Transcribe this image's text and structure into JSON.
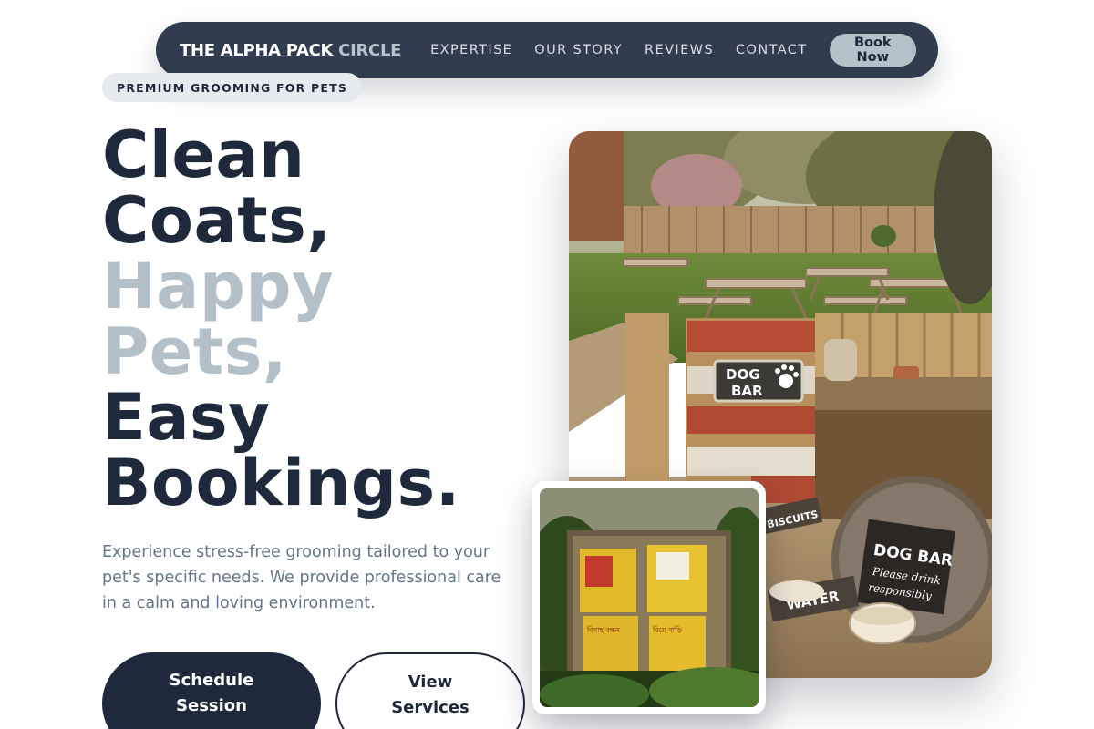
{
  "nav": {
    "brand_main": "THE ALPHA PACK",
    "brand_accent": "CIRCLE",
    "links": [
      "EXPERTISE",
      "OUR STORY",
      "REVIEWS",
      "CONTACT"
    ],
    "cta": "Book Now"
  },
  "hero": {
    "badge": "PREMIUM GROOMING FOR PETS",
    "headline": [
      "Clean",
      "Coats,",
      "Happy",
      "Pets,",
      "Easy",
      "Bookings."
    ],
    "lead": "Experience stress-free grooming tailored to your pet's specific needs. We provide professional care in a calm and loving environment.",
    "primary_cta": "Schedule Session",
    "secondary_cta": "View Services"
  },
  "images": {
    "main": {
      "sign_dog_bar": [
        "DOG",
        "BAR"
      ],
      "sign_round": [
        "DOG BAR",
        "Please drink",
        "responsibly"
      ],
      "sign_water": "WATER",
      "sign_biscuits": "BISCUITS"
    },
    "small": {
      "poster_lines": [
        "বিবাহ বন্ধন",
        "বিয়ে বাড়ি"
      ]
    }
  },
  "colors": {
    "navy": "#1e293b",
    "nav_bg": "#313d4f",
    "accent_slate": "#b3c0c7",
    "muted_text": "#64748b"
  }
}
